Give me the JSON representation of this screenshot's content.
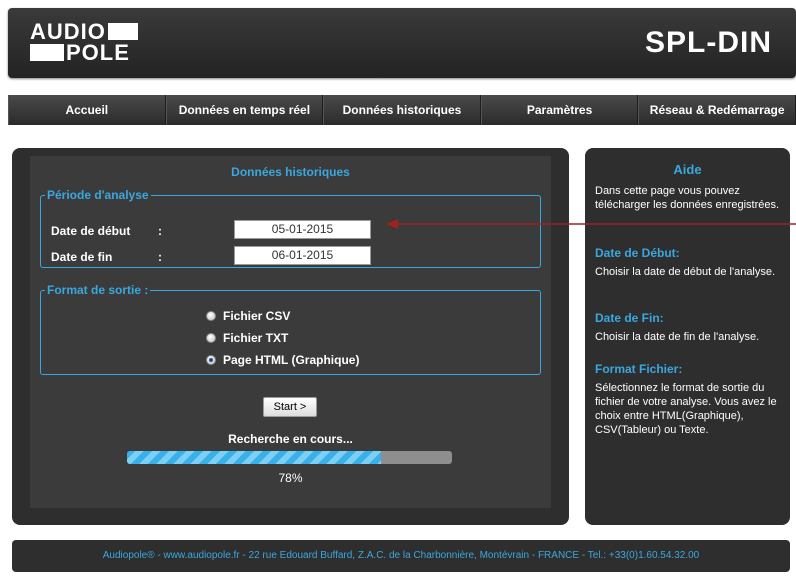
{
  "header": {
    "logo_top": "AUDIO",
    "logo_bottom": "POLE",
    "title": "SPL-DIN"
  },
  "nav": {
    "items": [
      {
        "label": "Accueil"
      },
      {
        "label": "Données en temps réel"
      },
      {
        "label": "Données historiques"
      },
      {
        "label": "Paramètres"
      },
      {
        "label": "Réseau & Redémarrage"
      }
    ]
  },
  "main": {
    "title": "Données historiques",
    "period": {
      "legend": "Période d'analyse",
      "start_label": "Date de début",
      "start_colon": ":",
      "start_value": "05-01-2015",
      "end_label": "Date de fin",
      "end_colon": ":",
      "end_value": "06-01-2015"
    },
    "format": {
      "legend": "Format de sortie  :",
      "options": [
        {
          "label": "Fichier CSV",
          "checked": false
        },
        {
          "label": "Fichier TXT",
          "checked": false
        },
        {
          "label": "Page HTML (Graphique)",
          "checked": true
        }
      ]
    },
    "start_button": "Start >",
    "status": "Recherche en cours...",
    "progress_percent": 78,
    "progress_label": "78%"
  },
  "help": {
    "title": "Aide",
    "intro": "Dans cette page vous pouvez télécharger les données enregistrées.",
    "start_heading": "Date de Début:",
    "start_text": "Choisir la date de début de l'analyse.",
    "end_heading": "Date de Fin:",
    "end_text": "Choisir la date de fin de l'analyse.",
    "format_heading": "Format Fichier:",
    "format_text": "Sélectionnez le format de sortie du fichier de votre analyse. Vous avez le choix entre HTML(Graphique), CSV(Tableur) ou Texte."
  },
  "footer": {
    "text": "Audiopole® - www.audiopole.fr - 22 rue Edouard Buffard, Z.A.C. de la Charbonnière, Montévrain - FRANCE - Tel.: +33(0)1.60.54.32.00"
  },
  "colors": {
    "accent": "#3aa8e0",
    "panel": "#2e2e2e",
    "inner": "#3b3b3b",
    "arrow": "#a32020"
  }
}
